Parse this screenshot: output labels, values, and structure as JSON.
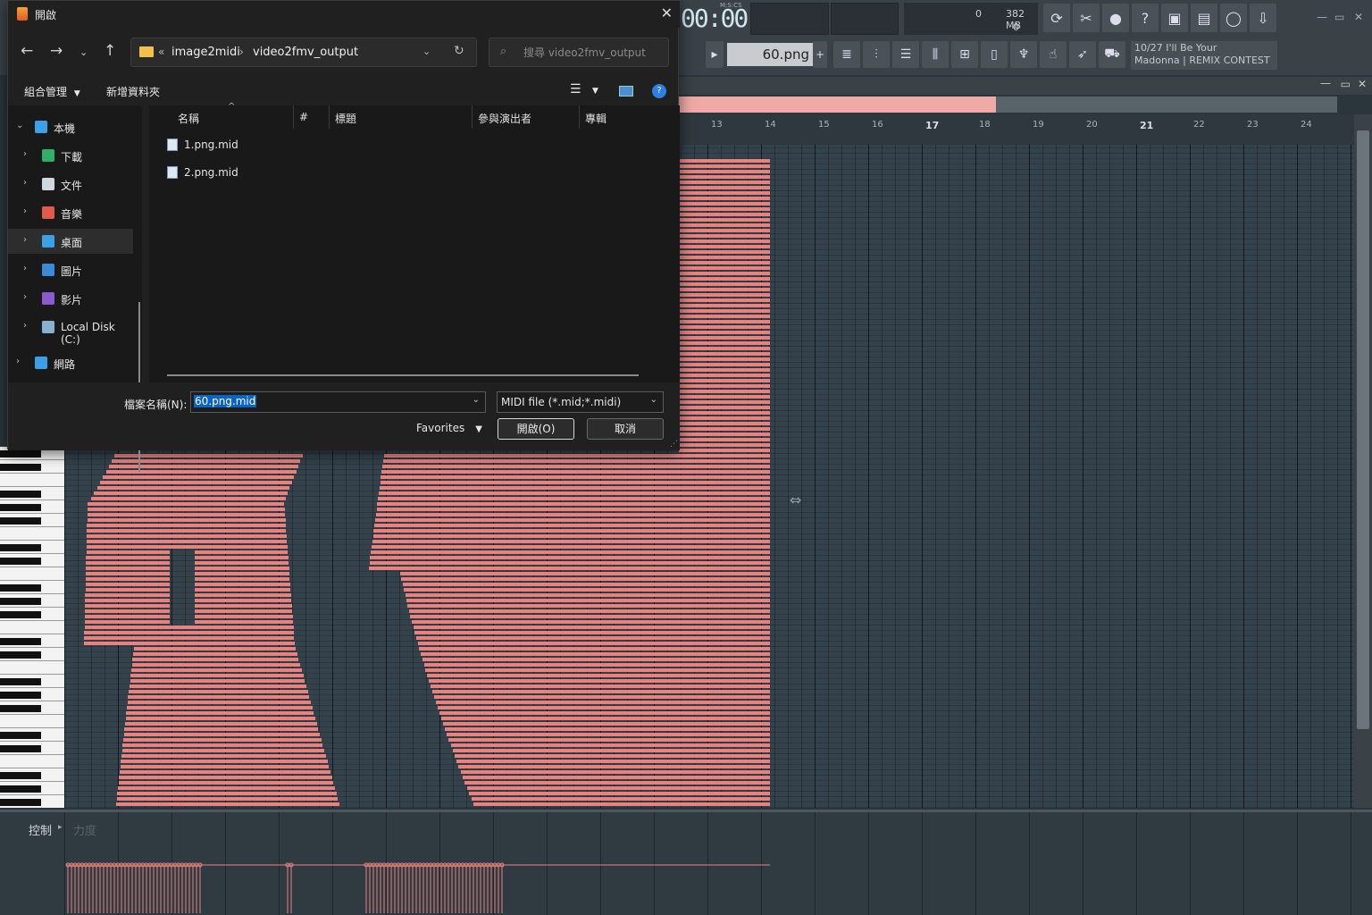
{
  "dialog": {
    "title": "開啟",
    "breadcrumb": [
      "image2midi",
      "video2fmv_output"
    ],
    "breadcrumb_prefix": "«",
    "search_placeholder": "搜尋 video2fmv_output",
    "commands": {
      "organize": "組合管理",
      "new_folder": "新增資料夾"
    },
    "nav": [
      {
        "label": "本機",
        "icon": "computer-icon",
        "expanded": true
      },
      {
        "label": "下載",
        "icon": "download-icon"
      },
      {
        "label": "文件",
        "icon": "document-icon"
      },
      {
        "label": "音樂",
        "icon": "music-icon"
      },
      {
        "label": "桌面",
        "icon": "desktop-icon",
        "selected": true
      },
      {
        "label": "圖片",
        "icon": "pictures-icon"
      },
      {
        "label": "影片",
        "icon": "videos-icon"
      },
      {
        "label": "Local Disk (C:)",
        "icon": "drive-icon"
      },
      {
        "label": "網路",
        "icon": "network-icon"
      }
    ],
    "columns": [
      "名稱",
      "#",
      "標題",
      "參與演出者",
      "專輯"
    ],
    "files": [
      "1.png.mid",
      "2.png.mid"
    ],
    "filename_label": "檔案名稱(N):",
    "filename_value": "60.png.mid",
    "filetype_value": "MIDI file (*.mid;*.midi)",
    "favorites_label": "Favorites",
    "open_label": "開啟(O)",
    "cancel_label": "取消"
  },
  "fl": {
    "time": "00:00",
    "time_mode": "M:S:CS",
    "memory": "382 MB",
    "cpu": "0",
    "polyphony": "0",
    "pattern": "60.png",
    "news_line1": "10/27  I'll Be Your",
    "news_line2": "Madonna | REMIX CONTEST",
    "control_label": "控制",
    "param_label": "力度",
    "ruler": [
      {
        "n": "13",
        "major": false
      },
      {
        "n": "14",
        "major": false
      },
      {
        "n": "15",
        "major": false
      },
      {
        "n": "16",
        "major": false
      },
      {
        "n": "17",
        "major": true
      },
      {
        "n": "18",
        "major": false
      },
      {
        "n": "19",
        "major": false
      },
      {
        "n": "20",
        "major": false
      },
      {
        "n": "21",
        "major": true
      },
      {
        "n": "22",
        "major": false
      },
      {
        "n": "23",
        "major": false
      },
      {
        "n": "24",
        "major": false
      }
    ],
    "note_color": "#e8827f",
    "accent_blue": "#0a64c8"
  }
}
